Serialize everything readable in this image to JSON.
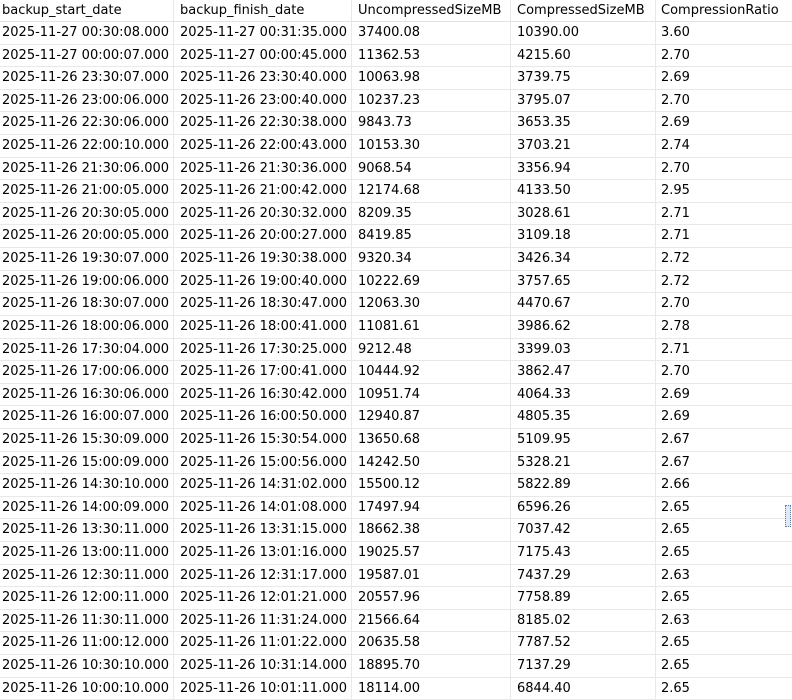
{
  "grid": {
    "columns": [
      "backup_start_date",
      "backup_finish_date",
      "UncompressedSizeMB",
      "CompressedSizeMB",
      "CompressionRatio"
    ],
    "rows": [
      [
        "2025-11-27 00:30:08.000",
        "2025-11-27 00:31:35.000",
        "37400.08",
        "10390.00",
        "3.60"
      ],
      [
        "2025-11-27 00:00:07.000",
        "2025-11-27 00:00:45.000",
        "11362.53",
        "4215.60",
        "2.70"
      ],
      [
        "2025-11-26 23:30:07.000",
        "2025-11-26 23:30:40.000",
        "10063.98",
        "3739.75",
        "2.69"
      ],
      [
        "2025-11-26 23:00:06.000",
        "2025-11-26 23:00:40.000",
        "10237.23",
        "3795.07",
        "2.70"
      ],
      [
        "2025-11-26 22:30:06.000",
        "2025-11-26 22:30:38.000",
        "9843.73",
        "3653.35",
        "2.69"
      ],
      [
        "2025-11-26 22:00:10.000",
        "2025-11-26 22:00:43.000",
        "10153.30",
        "3703.21",
        "2.74"
      ],
      [
        "2025-11-26 21:30:06.000",
        "2025-11-26 21:30:36.000",
        "9068.54",
        "3356.94",
        "2.70"
      ],
      [
        "2025-11-26 21:00:05.000",
        "2025-11-26 21:00:42.000",
        "12174.68",
        "4133.50",
        "2.95"
      ],
      [
        "2025-11-26 20:30:05.000",
        "2025-11-26 20:30:32.000",
        "8209.35",
        "3028.61",
        "2.71"
      ],
      [
        "2025-11-26 20:00:05.000",
        "2025-11-26 20:00:27.000",
        "8419.85",
        "3109.18",
        "2.71"
      ],
      [
        "2025-11-26 19:30:07.000",
        "2025-11-26 19:30:38.000",
        "9320.34",
        "3426.34",
        "2.72"
      ],
      [
        "2025-11-26 19:00:06.000",
        "2025-11-26 19:00:40.000",
        "10222.69",
        "3757.65",
        "2.72"
      ],
      [
        "2025-11-26 18:30:07.000",
        "2025-11-26 18:30:47.000",
        "12063.30",
        "4470.67",
        "2.70"
      ],
      [
        "2025-11-26 18:00:06.000",
        "2025-11-26 18:00:41.000",
        "11081.61",
        "3986.62",
        "2.78"
      ],
      [
        "2025-11-26 17:30:04.000",
        "2025-11-26 17:30:25.000",
        "9212.48",
        "3399.03",
        "2.71"
      ],
      [
        "2025-11-26 17:00:06.000",
        "2025-11-26 17:00:41.000",
        "10444.92",
        "3862.47",
        "2.70"
      ],
      [
        "2025-11-26 16:30:06.000",
        "2025-11-26 16:30:42.000",
        "10951.74",
        "4064.33",
        "2.69"
      ],
      [
        "2025-11-26 16:00:07.000",
        "2025-11-26 16:00:50.000",
        "12940.87",
        "4805.35",
        "2.69"
      ],
      [
        "2025-11-26 15:30:09.000",
        "2025-11-26 15:30:54.000",
        "13650.68",
        "5109.95",
        "2.67"
      ],
      [
        "2025-11-26 15:00:09.000",
        "2025-11-26 15:00:56.000",
        "14242.50",
        "5328.21",
        "2.67"
      ],
      [
        "2025-11-26 14:30:10.000",
        "2025-11-26 14:31:02.000",
        "15500.12",
        "5822.89",
        "2.66"
      ],
      [
        "2025-11-26 14:00:09.000",
        "2025-11-26 14:01:08.000",
        "17497.94",
        "6596.26",
        "2.65"
      ],
      [
        "2025-11-26 13:30:11.000",
        "2025-11-26 13:31:15.000",
        "18662.38",
        "7037.42",
        "2.65"
      ],
      [
        "2025-11-26 13:00:11.000",
        "2025-11-26 13:01:16.000",
        "19025.57",
        "7175.43",
        "2.65"
      ],
      [
        "2025-11-26 12:30:11.000",
        "2025-11-26 12:31:17.000",
        "19587.01",
        "7437.29",
        "2.63"
      ],
      [
        "2025-11-26 12:00:11.000",
        "2025-11-26 12:01:21.000",
        "20557.96",
        "7758.89",
        "2.65"
      ],
      [
        "2025-11-26 11:30:11.000",
        "2025-11-26 11:31:24.000",
        "21566.64",
        "8185.02",
        "2.63"
      ],
      [
        "2025-11-26 11:00:12.000",
        "2025-11-26 11:01:22.000",
        "20635.58",
        "7787.52",
        "2.65"
      ],
      [
        "2025-11-26 10:30:10.000",
        "2025-11-26 10:31:14.000",
        "18895.70",
        "7137.29",
        "2.65"
      ],
      [
        "2025-11-26 10:00:10.000",
        "2025-11-26 10:01:11.000",
        "18114.00",
        "6844.40",
        "2.65"
      ]
    ]
  }
}
